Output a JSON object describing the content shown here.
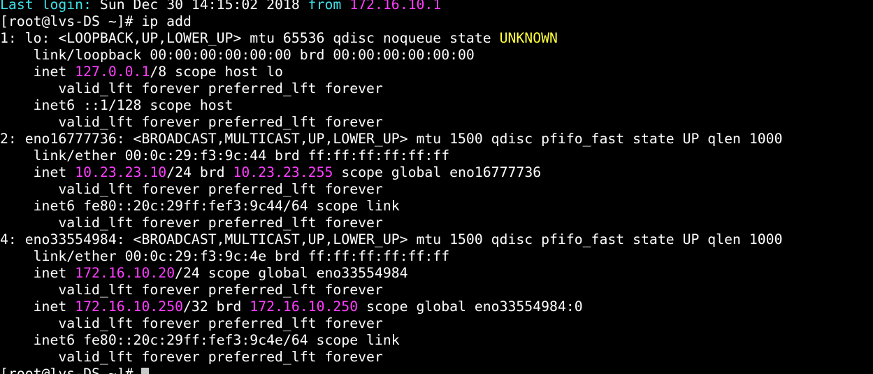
{
  "terminal": {
    "colors": {
      "background": "#000000",
      "foreground": "#ffffff",
      "cyan": "#3ee0e8",
      "magenta": "#ff3dff",
      "yellow": "#ffff3c"
    },
    "lines": [
      [
        {
          "text": "Last login:",
          "color": "cyan"
        },
        {
          "text": " Sun Dec 30 14:15:02 2018 "
        },
        {
          "text": "from",
          "color": "cyan"
        },
        {
          "text": " "
        },
        {
          "text": "172.16.10.1",
          "color": "magenta"
        }
      ],
      [
        {
          "text": "[root@lvs-DS ~]# ip add"
        }
      ],
      [
        {
          "text": "1: lo: <LOOPBACK,UP,LOWER_UP> mtu 65536 qdisc noqueue state "
        },
        {
          "text": "UNKNOWN",
          "color": "yellow"
        }
      ],
      [
        {
          "text": "    link/loopback 00:00:00:00:00:00 brd 00:00:00:00:00:00"
        }
      ],
      [
        {
          "text": "    inet "
        },
        {
          "text": "127.0.0.1",
          "color": "magenta"
        },
        {
          "text": "/8 scope host lo"
        }
      ],
      [
        {
          "text": "       valid_lft forever preferred_lft forever"
        }
      ],
      [
        {
          "text": "    inet6 ::1/128 scope host"
        }
      ],
      [
        {
          "text": "       valid_lft forever preferred_lft forever"
        }
      ],
      [
        {
          "text": "2: eno16777736: <BROADCAST,MULTICAST,UP,LOWER_UP> mtu 1500 qdisc pfifo_fast state UP qlen 1000"
        }
      ],
      [
        {
          "text": "    link/ether 00:0c:29:f3:9c:44 brd ff:ff:ff:ff:ff:ff"
        }
      ],
      [
        {
          "text": "    inet "
        },
        {
          "text": "10.23.23.10",
          "color": "magenta"
        },
        {
          "text": "/24 brd "
        },
        {
          "text": "10.23.23.255",
          "color": "magenta"
        },
        {
          "text": " scope global eno16777736"
        }
      ],
      [
        {
          "text": "       valid_lft forever preferred_lft forever"
        }
      ],
      [
        {
          "text": "    inet6 fe80::20c:29ff:fef3:9c44/64 scope link"
        }
      ],
      [
        {
          "text": "       valid_lft forever preferred_lft forever"
        }
      ],
      [
        {
          "text": "4: eno33554984: <BROADCAST,MULTICAST,UP,LOWER_UP> mtu 1500 qdisc pfifo_fast state UP qlen 1000"
        }
      ],
      [
        {
          "text": "    link/ether 00:0c:29:f3:9c:4e brd ff:ff:ff:ff:ff:ff"
        }
      ],
      [
        {
          "text": "    inet "
        },
        {
          "text": "172.16.10.20",
          "color": "magenta"
        },
        {
          "text": "/24 scope global eno33554984"
        }
      ],
      [
        {
          "text": "       valid_lft forever preferred_lft forever"
        }
      ],
      [
        {
          "text": "    inet "
        },
        {
          "text": "172.16.10.250",
          "color": "magenta"
        },
        {
          "text": "/32 brd "
        },
        {
          "text": "172.16.10.250",
          "color": "magenta"
        },
        {
          "text": " scope global eno33554984:0"
        }
      ],
      [
        {
          "text": "       valid_lft forever preferred_lft forever"
        }
      ],
      [
        {
          "text": "    inet6 fe80::20c:29ff:fef3:9c4e/64 scope link"
        }
      ],
      [
        {
          "text": "       valid_lft forever preferred_lft forever"
        }
      ],
      [
        {
          "text": "[root@lvs-DS ~]# "
        }
      ]
    ]
  }
}
